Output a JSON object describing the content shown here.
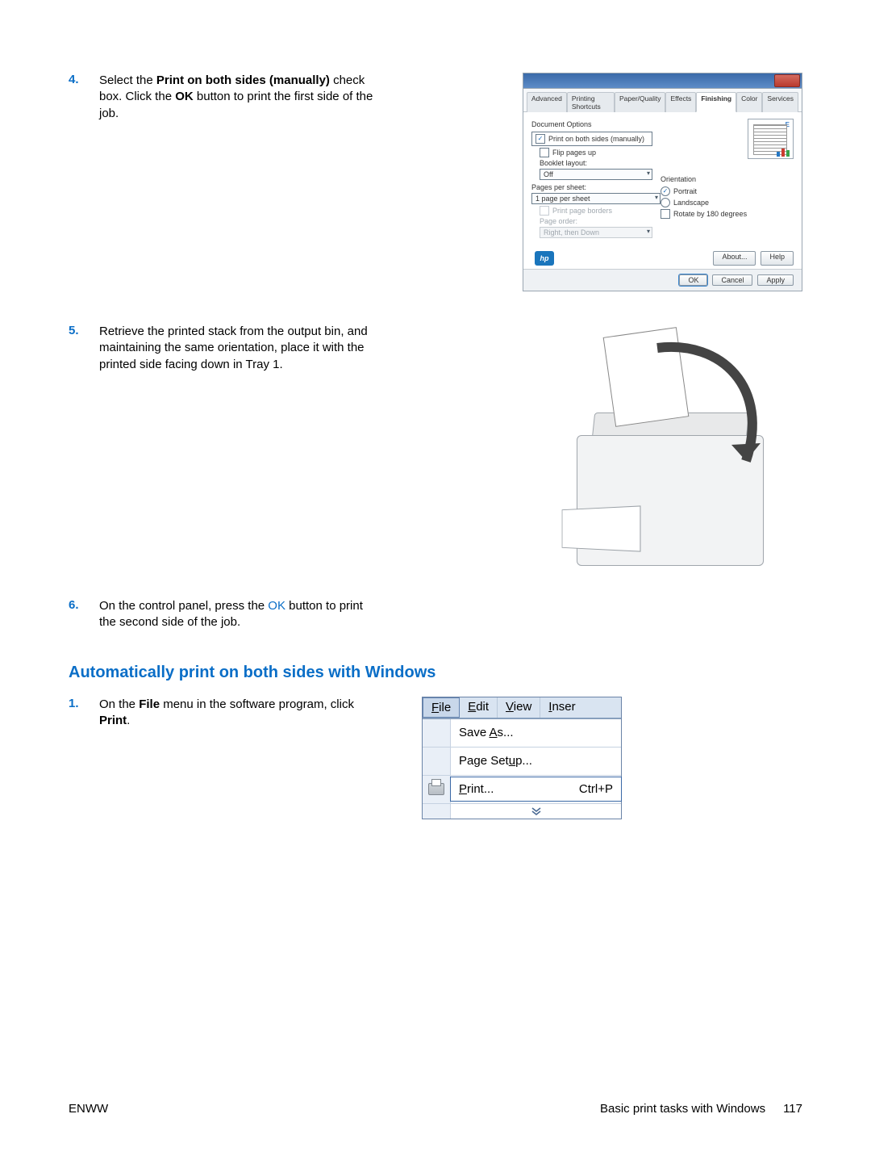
{
  "steps": {
    "s4": {
      "num": "4.",
      "pre": "Select the ",
      "bold1": "Print on both sides (manually)",
      "mid": " check box. Click the ",
      "bold2": "OK",
      "post": " button to print the first side of the job."
    },
    "s5": {
      "num": "5.",
      "text": "Retrieve the printed stack from the output bin, and maintaining the same orientation, place it with the printed side facing down in Tray 1."
    },
    "s6": {
      "num": "6.",
      "pre": "On the control panel, press the ",
      "ok": "OK",
      "post": " button to print the second side of the job."
    },
    "auto1": {
      "num": "1.",
      "pre": "On the ",
      "bold1": "File",
      "mid": " menu in the software program, click ",
      "bold2": "Print",
      "post": "."
    }
  },
  "section_heading": "Automatically print on both sides with Windows",
  "dialog": {
    "tabs": [
      "Advanced",
      "Printing Shortcuts",
      "Paper/Quality",
      "Effects",
      "Finishing",
      "Color",
      "Services"
    ],
    "active_tab": "Finishing",
    "doc_options": "Document Options",
    "print_both": "Print on both sides (manually)",
    "flip_up": "Flip pages up",
    "booklet_label": "Booklet layout:",
    "booklet_value": "Off",
    "pps_label": "Pages per sheet:",
    "pps_value": "1 page per sheet",
    "print_borders": "Print page borders",
    "page_order_label": "Page order:",
    "page_order_value": "Right, then Down",
    "orientation": "Orientation",
    "portrait": "Portrait",
    "landscape": "Landscape",
    "rotate": "Rotate by 180 degrees",
    "about": "About...",
    "help": "Help",
    "ok": "OK",
    "cancel": "Cancel",
    "apply": "Apply",
    "hp": "hp"
  },
  "menu": {
    "file": "File",
    "edit": "Edit",
    "view": "View",
    "insert": "Inser",
    "save_as": "Save As...",
    "page_setup": "Page Setup...",
    "print": "Print...",
    "print_short": "Ctrl+P"
  },
  "footer": {
    "left": "ENWW",
    "right": "Basic print tasks with Windows",
    "page": "117"
  }
}
